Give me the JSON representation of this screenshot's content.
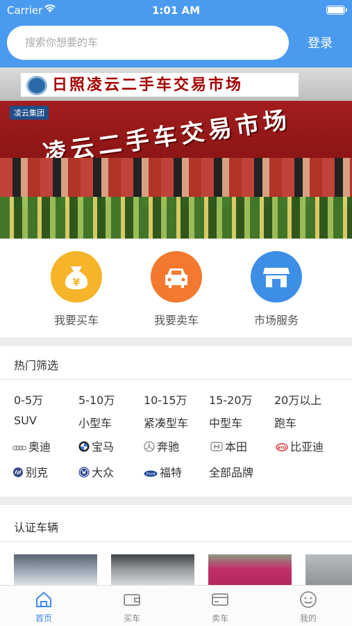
{
  "status_bar": {
    "carrier": "Carrier",
    "time": "1:01 AM"
  },
  "header": {
    "search_placeholder": "搜索你想要的车",
    "login_label": "登录",
    "accent": "#4a9af0"
  },
  "banner": {
    "top_sign": "日照凌云二手车交易市场",
    "stage_text": "凌云二手车交易市场",
    "brand": "凌云集团"
  },
  "features": [
    {
      "label": "我要买车",
      "icon": "money-bag-icon",
      "color": "#f5b42a"
    },
    {
      "label": "我要卖车",
      "icon": "car-icon",
      "color": "#f2792e"
    },
    {
      "label": "市场服务",
      "icon": "store-icon",
      "color": "#3d8fe6"
    }
  ],
  "hot_filter": {
    "title": "热门筛选",
    "prices": [
      "0-5万",
      "5-10万",
      "10-15万",
      "15-20万",
      "20万以上"
    ],
    "types": [
      "SUV",
      "小型车",
      "紧凑型车",
      "中型车",
      "跑车"
    ],
    "brands_row1": [
      {
        "name": "奥迪",
        "icon": "audi-icon"
      },
      {
        "name": "宝马",
        "icon": "bmw-icon"
      },
      {
        "name": "奔驰",
        "icon": "mercedes-icon"
      },
      {
        "name": "本田",
        "icon": "honda-icon"
      },
      {
        "name": "比亚迪",
        "icon": "byd-icon"
      }
    ],
    "brands_row2": [
      {
        "name": "别克",
        "icon": "buick-icon"
      },
      {
        "name": "大众",
        "icon": "volkswagen-icon"
      },
      {
        "name": "福特",
        "icon": "ford-icon"
      },
      {
        "name": "全部品牌",
        "icon": ""
      }
    ]
  },
  "certified": {
    "title": "认证车辆"
  },
  "tabs": [
    {
      "label": "首页",
      "icon": "home-icon",
      "active": true
    },
    {
      "label": "买车",
      "icon": "wallet-icon",
      "active": false
    },
    {
      "label": "卖车",
      "icon": "card-icon",
      "active": false
    },
    {
      "label": "我的",
      "icon": "smiley-icon",
      "active": false
    }
  ]
}
